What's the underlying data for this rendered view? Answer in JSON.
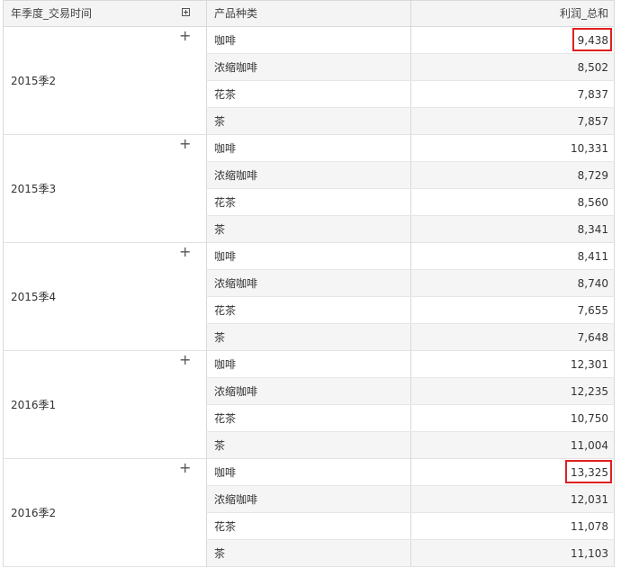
{
  "table": {
    "headers": {
      "time": "年季度_交易时间",
      "product": "产品种类",
      "profit": "利润_总和"
    },
    "groups": [
      {
        "label": "2015季2",
        "rows": [
          {
            "product": "咖啡",
            "value": "9,438",
            "highlighted": true
          },
          {
            "product": "浓缩咖啡",
            "value": "8,502"
          },
          {
            "product": "花茶",
            "value": "7,837"
          },
          {
            "product": "茶",
            "value": "7,857"
          }
        ]
      },
      {
        "label": "2015季3",
        "rows": [
          {
            "product": "咖啡",
            "value": "10,331"
          },
          {
            "product": "浓缩咖啡",
            "value": "8,729"
          },
          {
            "product": "花茶",
            "value": "8,560"
          },
          {
            "product": "茶",
            "value": "8,341"
          }
        ]
      },
      {
        "label": "2015季4",
        "rows": [
          {
            "product": "咖啡",
            "value": "8,411"
          },
          {
            "product": "浓缩咖啡",
            "value": "8,740"
          },
          {
            "product": "花茶",
            "value": "7,655"
          },
          {
            "product": "茶",
            "value": "7,648"
          }
        ]
      },
      {
        "label": "2016季1",
        "rows": [
          {
            "product": "咖啡",
            "value": "12,301"
          },
          {
            "product": "浓缩咖啡",
            "value": "12,235"
          },
          {
            "product": "花茶",
            "value": "10,750"
          },
          {
            "product": "茶",
            "value": "11,004"
          }
        ]
      },
      {
        "label": "2016季2",
        "rows": [
          {
            "product": "咖啡",
            "value": "13,325",
            "highlighted": true
          },
          {
            "product": "浓缩咖啡",
            "value": "12,031"
          },
          {
            "product": "花茶",
            "value": "11,078"
          },
          {
            "product": "茶",
            "value": "11,103"
          }
        ]
      }
    ],
    "icons": {
      "expand_all": "expand-all-icon",
      "expand_row": "plus-icon"
    },
    "colors": {
      "highlight": "#e02020",
      "header_bg": "#f4f4f4",
      "alt_row_bg": "#f5f5f5"
    }
  }
}
